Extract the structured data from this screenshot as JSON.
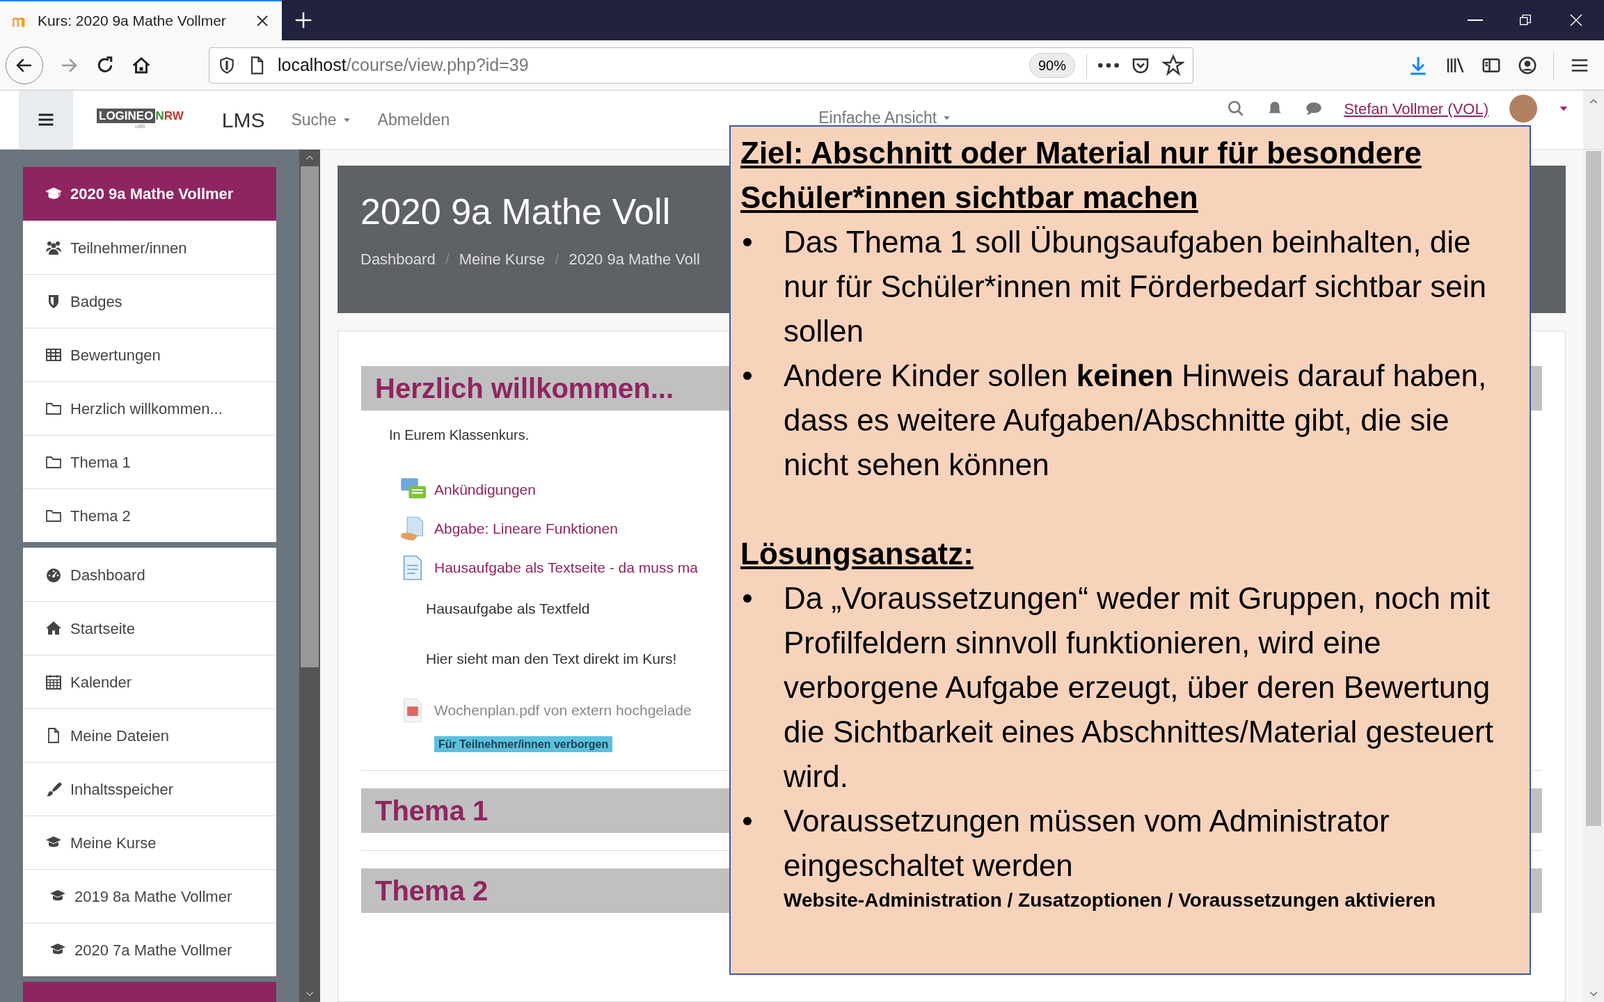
{
  "browser": {
    "tab_title": "Kurs: 2020 9a Mathe Vollmer",
    "url_host": "localhost",
    "url_path": "/course/view.php?id=39",
    "zoom": "90%"
  },
  "navbar": {
    "logo": {
      "left": "LOGINEO",
      "right": "NRW",
      "sub": "LMS"
    },
    "brand": "LMS",
    "menu": [
      {
        "label": "Suche",
        "dropdown": true
      },
      {
        "label": "Abmelden",
        "dropdown": false
      }
    ],
    "view_mode": "Einfache Ansicht",
    "user": "Stefan Vollmer (VOL)"
  },
  "sidebar": {
    "groups": [
      [
        {
          "kind": "course",
          "label": "2020 9a Mathe Vollmer",
          "selected": true
        },
        {
          "kind": "participants",
          "label": "Teilnehmer/innen",
          "selected": false
        },
        {
          "kind": "badges",
          "label": "Badges",
          "selected": false
        },
        {
          "kind": "grades",
          "label": "Bewertungen",
          "selected": false
        },
        {
          "kind": "section",
          "label": "Herzlich willkommen...",
          "selected": false
        },
        {
          "kind": "section",
          "label": "Thema 1",
          "selected": false
        },
        {
          "kind": "section",
          "label": "Thema 2",
          "selected": false
        }
      ],
      [
        {
          "kind": "dashboard",
          "label": "Dashboard",
          "selected": false
        },
        {
          "kind": "home",
          "label": "Startseite",
          "selected": false
        },
        {
          "kind": "calendar",
          "label": "Kalender",
          "selected": false
        },
        {
          "kind": "files",
          "label": "Meine Dateien",
          "selected": false
        },
        {
          "kind": "contentbank",
          "label": "Inhaltsspeicher",
          "selected": false
        },
        {
          "kind": "mycourses",
          "label": "Meine Kurse",
          "selected": false
        },
        {
          "kind": "subcourse",
          "label": "2019 8a Mathe Vollmer",
          "selected": false
        },
        {
          "kind": "subcourse",
          "label": "2020 7a Mathe Vollmer",
          "selected": false
        }
      ]
    ]
  },
  "course_header": {
    "title": "2020 9a Mathe Voll",
    "breadcrumb_separator": "/",
    "breadcrumb": [
      "Dashboard",
      "Meine Kurse",
      "2020 9a Mathe Voll"
    ]
  },
  "sections": [
    {
      "title": "Herzlich willkommen...",
      "summary": "In Eurem Klassenkurs.",
      "activities": [
        {
          "kind": "forum",
          "name": "Ankündigungen",
          "hidden": false
        },
        {
          "kind": "assign",
          "name": "Abgabe: Lineare Funktionen",
          "hidden": false
        },
        {
          "kind": "page",
          "name": "Hausaufgabe als Textseite - da muss ma",
          "hidden": false
        },
        {
          "kind": "label",
          "lines": [
            "Hausaufgabe als Textfeld",
            "Hier sieht man den Text direkt im Kurs!"
          ],
          "hidden": false
        },
        {
          "kind": "resource",
          "name": "Wochenplan.pdf von extern hochgelade",
          "hidden": true,
          "badge": "Für Teilnehmer/innen verborgen"
        }
      ]
    },
    {
      "title": "Thema 1"
    },
    {
      "title": "Thema 2"
    }
  ],
  "overlay": {
    "heading": "Ziel: Abschnitt oder Material nur für besondere Schüler*innen sichtbar machen",
    "bullets": [
      "Das Thema 1 soll Übungsaufgaben beinhalten, die nur für Schüler*innen mit Förderbedarf sichtbar sein sollen",
      "Andere Kinder sollen **keinen** Hinweis darauf haben, dass es weitere Aufgaben/Abschnitte gibt, die sie nicht sehen können"
    ],
    "heading2": "Lösungsansatz:",
    "bullets2": [
      "Da „Voraussetzungen“ weder mit Gruppen, noch mit Profilfeldern sinnvoll funktionieren, wird eine verborgene Aufgabe erzeugt, über deren Bewertung die Sichtbarkeit eines Abschnittes/Material gesteuert wird.",
      "Voraussetzungen müssen vom Administrator eingeschaltet werden"
    ],
    "note": "Website-Administration / Zusatzoptionen / Voraussetzungen aktivieren"
  }
}
